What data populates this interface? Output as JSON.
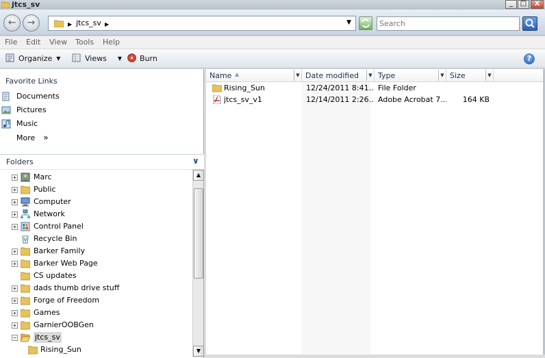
{
  "window": {
    "title": "jtcs_sv",
    "controls": {
      "minimize": "_",
      "maximize": "□",
      "close": "X"
    }
  },
  "address": {
    "crumbs": [
      "jtcs_sv"
    ],
    "search_placeholder": "Search"
  },
  "menu": [
    "File",
    "Edit",
    "View",
    "Tools",
    "Help"
  ],
  "toolbar": {
    "organize": "Organize",
    "views": "Views",
    "burn": "Burn",
    "help": "?"
  },
  "favorites": {
    "title": "Favorite Links",
    "items": [
      {
        "label": "Documents",
        "icon": "documents-icon"
      },
      {
        "label": "Pictures",
        "icon": "pictures-icon"
      },
      {
        "label": "Music",
        "icon": "music-icon"
      },
      {
        "label": "More",
        "icon": "chevrons-icon"
      }
    ]
  },
  "folders": {
    "title": "Folders",
    "items": [
      {
        "label": "Marc",
        "expander": "+",
        "icon": "user-folder-icon"
      },
      {
        "label": "Public",
        "expander": "+",
        "icon": "folder-icon"
      },
      {
        "label": "Computer",
        "expander": "+",
        "icon": "computer-icon"
      },
      {
        "label": "Network",
        "expander": "+",
        "icon": "network-icon"
      },
      {
        "label": "Control Panel",
        "expander": "+",
        "icon": "control-panel-icon"
      },
      {
        "label": "Recycle Bin",
        "expander": "",
        "icon": "recycle-bin-icon"
      },
      {
        "label": "Barker Family",
        "expander": "+",
        "icon": "folder-icon"
      },
      {
        "label": "Barker Web Page",
        "expander": "+",
        "icon": "folder-icon"
      },
      {
        "label": "CS updates",
        "expander": "",
        "icon": "folder-icon"
      },
      {
        "label": "dads thumb drive stuff",
        "expander": "+",
        "icon": "folder-icon"
      },
      {
        "label": "Forge of Freedom",
        "expander": "+",
        "icon": "folder-icon"
      },
      {
        "label": "Games",
        "expander": "+",
        "icon": "folder-icon"
      },
      {
        "label": "GarnierOOBGen",
        "expander": "+",
        "icon": "folder-icon"
      },
      {
        "label": "jtcs_sv",
        "expander": "−",
        "icon": "folder-open-icon",
        "selected": true
      },
      {
        "label": "Rising_Sun",
        "expander": "",
        "icon": "folder-icon",
        "child": true
      }
    ]
  },
  "columns": [
    "Name",
    "Date modified",
    "Type",
    "Size"
  ],
  "files": [
    {
      "name": "Rising_Sun",
      "date": "12/24/2011 8:41...",
      "type": "File Folder",
      "size": "",
      "icon": "folder-icon"
    },
    {
      "name": "jtcs_sv_v1",
      "date": "12/14/2011 2:26...",
      "type": "Adobe Acrobat 7...",
      "size": "164 KB",
      "icon": "pdf-icon"
    }
  ],
  "colors": {
    "folder": "#e8c25a",
    "selection": "#d9d9d9",
    "header_text": "#1e2e44"
  }
}
